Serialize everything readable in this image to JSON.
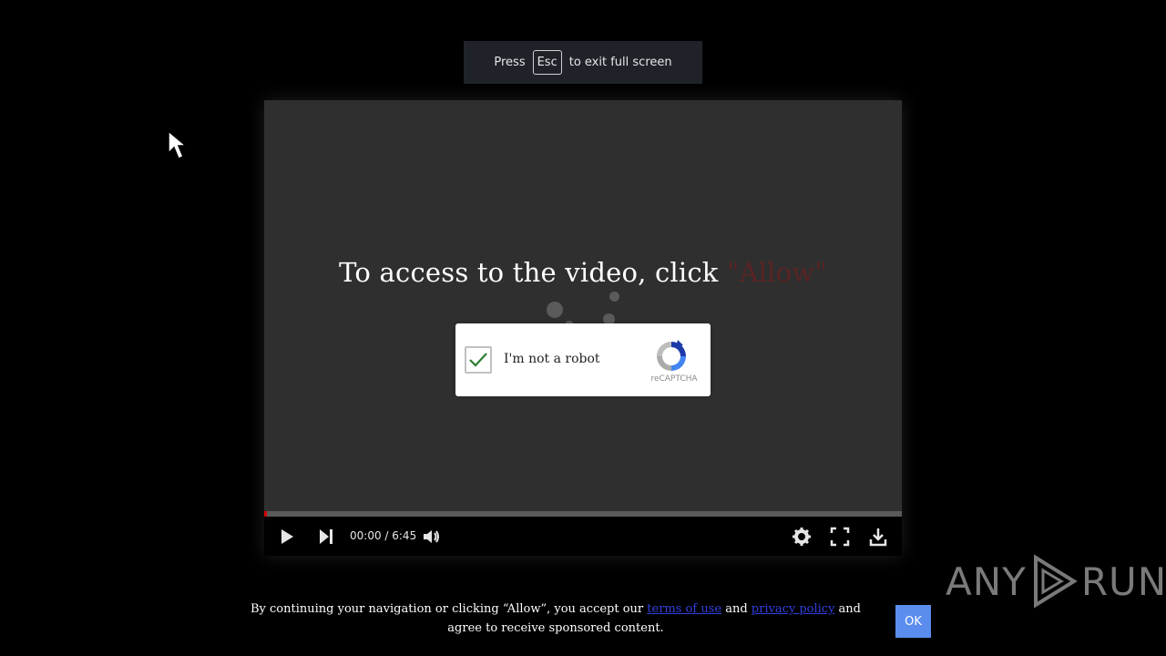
{
  "fullscreen_notice": {
    "prefix": "Press",
    "key": "Esc",
    "suffix": "to exit full screen"
  },
  "player": {
    "headline": "To access to the video, click ",
    "headline_highlight": "\"Allow\"",
    "time_display": "00:00 / 6:45",
    "progress_fraction": 0.0,
    "controls": [
      "play-icon",
      "next-icon",
      "volume-icon",
      "settings-icon",
      "fullscreen-icon",
      "download-icon"
    ]
  },
  "captcha": {
    "label": "I'm not a robot",
    "brand": "reCAPTCHA",
    "checked": true
  },
  "consent": {
    "text_before": "By continuing your navigation or clicking “Allow”, you accept our ",
    "terms_link": "terms of use",
    "text_middle": " and ",
    "privacy_link": "privacy policy",
    "text_after": " and agree to receive sponsored content.",
    "ok_label": "OK"
  },
  "watermark": {
    "left": "ANY",
    "right": "RUN"
  },
  "colors": {
    "background": "#000000",
    "player_bg": "#2f2f2f",
    "allow_highlight": "#5a2424",
    "link": "#3340e0",
    "ok_button": "#5b8def",
    "progress": "#d10000"
  }
}
